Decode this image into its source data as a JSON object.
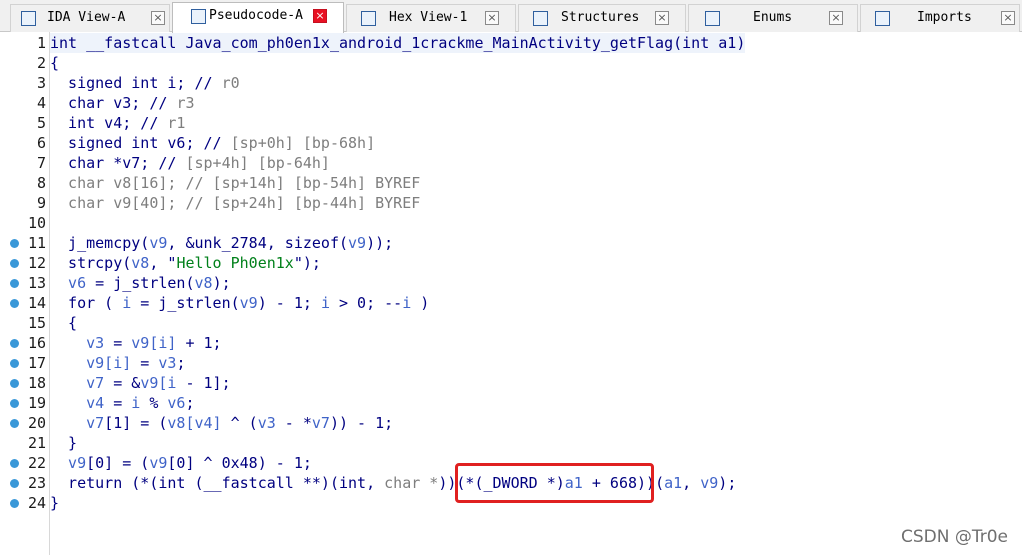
{
  "tabs": [
    {
      "label": "IDA View-A",
      "icon": "ida-view-icon",
      "active": false
    },
    {
      "label": "Pseudocode-A",
      "icon": "pseudocode-icon",
      "active": true
    },
    {
      "label": "Hex View-1",
      "icon": "hex-view-icon",
      "active": false
    },
    {
      "label": "Structures",
      "icon": "structures-icon",
      "active": false
    },
    {
      "label": "Enums",
      "icon": "enums-icon",
      "active": false
    },
    {
      "label": "Imports",
      "icon": "imports-icon",
      "active": false
    }
  ],
  "close_glyph": "×",
  "code_lines": [
    {
      "n": "1",
      "dot": false,
      "tokens": [
        [
          "k",
          "int __fastcall Java_com_ph0en1x_android_1crackme_MainActivity_getFlag(int a1)"
        ]
      ]
    },
    {
      "n": "2",
      "dot": false,
      "tokens": [
        [
          "k",
          "{"
        ]
      ]
    },
    {
      "n": "3",
      "dot": false,
      "tokens": [
        [
          "k",
          "  signed int i; // "
        ],
        [
          "g",
          "r0"
        ]
      ]
    },
    {
      "n": "4",
      "dot": false,
      "tokens": [
        [
          "k",
          "  char v3; // "
        ],
        [
          "g",
          "r3"
        ]
      ]
    },
    {
      "n": "5",
      "dot": false,
      "tokens": [
        [
          "k",
          "  int v4; // "
        ],
        [
          "g",
          "r1"
        ]
      ]
    },
    {
      "n": "6",
      "dot": false,
      "tokens": [
        [
          "k",
          "  signed int v6; // "
        ],
        [
          "g",
          "[sp+0h] [bp-68h]"
        ]
      ]
    },
    {
      "n": "7",
      "dot": false,
      "tokens": [
        [
          "k",
          "  char *v7; // "
        ],
        [
          "g",
          "[sp+4h] [bp-64h]"
        ]
      ]
    },
    {
      "n": "8",
      "dot": false,
      "tokens": [
        [
          "g",
          "  char v8[16]; // [sp+14h] [bp-54h] BYREF"
        ]
      ]
    },
    {
      "n": "9",
      "dot": false,
      "tokens": [
        [
          "g",
          "  char v9[40]; // [sp+24h] [bp-44h] BYREF"
        ]
      ]
    },
    {
      "n": "10",
      "dot": false,
      "tokens": [
        [
          "k",
          ""
        ]
      ]
    },
    {
      "n": "11",
      "dot": true,
      "tokens": [
        [
          "k",
          "  j_memcpy("
        ],
        [
          "v",
          "v9"
        ],
        [
          "k",
          ", &unk_2784, sizeof("
        ],
        [
          "v",
          "v9"
        ],
        [
          "k",
          "));"
        ]
      ]
    },
    {
      "n": "12",
      "dot": true,
      "tokens": [
        [
          "k",
          "  strcpy("
        ],
        [
          "v",
          "v8"
        ],
        [
          "k",
          ", \""
        ],
        [
          "s",
          "Hello Ph0en1x"
        ],
        [
          "k",
          "\");"
        ]
      ]
    },
    {
      "n": "13",
      "dot": true,
      "tokens": [
        [
          "v",
          "  v6"
        ],
        [
          "k",
          " = j_strlen("
        ],
        [
          "v",
          "v8"
        ],
        [
          "k",
          ");"
        ]
      ]
    },
    {
      "n": "14",
      "dot": true,
      "tokens": [
        [
          "k",
          "  for ( "
        ],
        [
          "v",
          "i"
        ],
        [
          "k",
          " = j_strlen("
        ],
        [
          "v",
          "v9"
        ],
        [
          "k",
          ") - 1; "
        ],
        [
          "v",
          "i"
        ],
        [
          "k",
          " > 0; --"
        ],
        [
          "v",
          "i"
        ],
        [
          "k",
          " )"
        ]
      ]
    },
    {
      "n": "15",
      "dot": false,
      "tokens": [
        [
          "k",
          "  {"
        ]
      ]
    },
    {
      "n": "16",
      "dot": true,
      "tokens": [
        [
          "v",
          "    v3"
        ],
        [
          "k",
          " = "
        ],
        [
          "v",
          "v9[i]"
        ],
        [
          "k",
          " + 1;"
        ]
      ]
    },
    {
      "n": "17",
      "dot": true,
      "tokens": [
        [
          "v",
          "    v9[i]"
        ],
        [
          "k",
          " = "
        ],
        [
          "v",
          "v3"
        ],
        [
          "k",
          ";"
        ]
      ]
    },
    {
      "n": "18",
      "dot": true,
      "tokens": [
        [
          "v",
          "    v7"
        ],
        [
          "k",
          " = &"
        ],
        [
          "v",
          "v9[i"
        ],
        [
          "k",
          " - 1];"
        ]
      ]
    },
    {
      "n": "19",
      "dot": true,
      "tokens": [
        [
          "v",
          "    v4"
        ],
        [
          "k",
          " = "
        ],
        [
          "v",
          "i"
        ],
        [
          "k",
          " % "
        ],
        [
          "v",
          "v6"
        ],
        [
          "k",
          ";"
        ]
      ]
    },
    {
      "n": "20",
      "dot": true,
      "tokens": [
        [
          "v",
          "    v7"
        ],
        [
          "k",
          "[1] = ("
        ],
        [
          "v",
          "v8[v4]"
        ],
        [
          "k",
          " ^ ("
        ],
        [
          "v",
          "v3"
        ],
        [
          "k",
          " - *"
        ],
        [
          "v",
          "v7"
        ],
        [
          "k",
          ")) - 1;"
        ]
      ]
    },
    {
      "n": "21",
      "dot": false,
      "tokens": [
        [
          "k",
          "  }"
        ]
      ]
    },
    {
      "n": "22",
      "dot": true,
      "tokens": [
        [
          "v",
          "  v9"
        ],
        [
          "k",
          "[0] = ("
        ],
        [
          "v",
          "v9"
        ],
        [
          "k",
          "[0] ^ 0x48) - 1;"
        ]
      ]
    },
    {
      "n": "23",
      "dot": true,
      "tokens": [
        [
          "k",
          "  return (*(int (__fastcall **)(int, "
        ],
        [
          "g",
          "char *"
        ],
        [
          "k",
          "))(*(_DWORD *)"
        ],
        [
          "v",
          "a1"
        ],
        [
          "k",
          " + 668))("
        ],
        [
          "v",
          "a1"
        ],
        [
          "k",
          ", "
        ],
        [
          "v",
          "v9"
        ],
        [
          "k",
          ");"
        ]
      ]
    },
    {
      "n": "24",
      "dot": true,
      "tokens": [
        [
          "k",
          "}"
        ]
      ]
    }
  ],
  "watermark": "CSDN @Tr0e",
  "colors": {
    "keyword": "#000080",
    "comment": "#7e7e7e",
    "variable": "#3f63c8",
    "string": "#00801a",
    "breakpoint_dot": "#3a98d8",
    "highlight_box": "#e02020",
    "active_tab_close": "#e81123"
  }
}
